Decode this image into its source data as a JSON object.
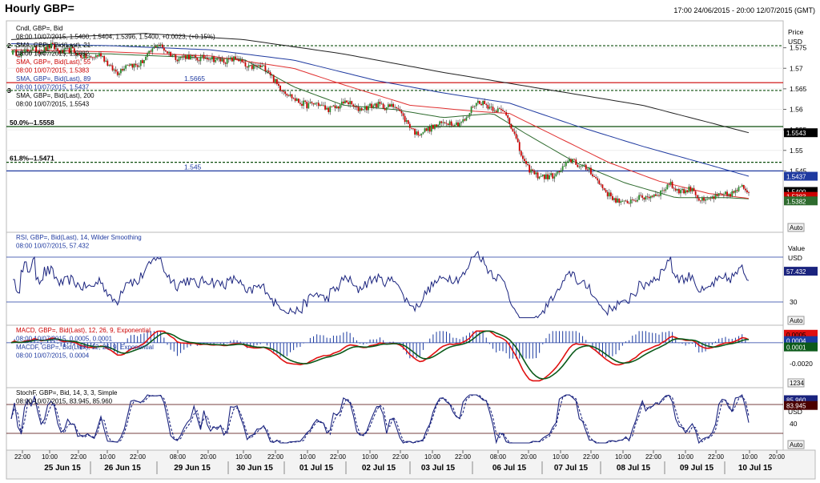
{
  "header": {
    "title": "Hourly GBP=",
    "date_range": "17:00 24/06/2015 - 20:00 12/07/2015 (GMT)"
  },
  "colors": {
    "candle_up": "#2a8a2a",
    "candle_down": "#cc0000",
    "sma21": "#2e6b2e",
    "sma55": "#e03030",
    "sma89": "#1f3aa0",
    "sma200": "#222222",
    "rsi": "#1a237e",
    "macd": "#e01010",
    "macdf": "#0b5a1a",
    "stoch_k": "#1a237e",
    "stoch_d": "#1a237e"
  },
  "price_panel": {
    "legend": [
      {
        "text": "Cndl, GBP=, Bid",
        "color": "#000000"
      },
      {
        "text": "08:00 10/07/2015, 1.5400, 1.5404, 1.5396, 1.5400, +0.0023, (+0.15%)",
        "color": "#000000"
      },
      {
        "text": "SMA, GBP=, Bid(Last), 21",
        "color": "#000000"
      },
      {
        "text": "08:00 10/07/2015, 1.5382",
        "color": "#000000"
      },
      {
        "text": "SMA, GBP=, Bid(Last), 55",
        "color": "#cc0000"
      },
      {
        "text": "08:00 10/07/2015, 1.5383",
        "color": "#cc0000"
      },
      {
        "text": "SMA, GBP=, Bid(Last), 89",
        "color": "#1f3aa0"
      },
      {
        "text": "08:00 10/07/2015, 1.5437",
        "color": "#1f3aa0"
      },
      {
        "text": "SMA, GBP=, Bid(Last), 200",
        "color": "#000000"
      },
      {
        "text": "08:00 10/07/2015, 1.5543",
        "color": "#000000"
      }
    ],
    "axis_title": "Price",
    "axis_unit": "USD",
    "ticks": [
      "1.575",
      "1.57",
      "1.565",
      "1.56",
      "1.555",
      "1.55",
      "1.545"
    ],
    "tick_values": [
      1.575,
      1.57,
      1.565,
      1.56,
      1.555,
      1.55,
      1.545
    ],
    "ylim": [
      1.532,
      1.58
    ],
    "badges": [
      {
        "text": "1.5543",
        "value": 1.5543,
        "bg": "#000000",
        "fg": "#ffffff"
      },
      {
        "text": "1.5437",
        "value": 1.5437,
        "bg": "#1f3aa0",
        "fg": "#ffffff"
      },
      {
        "text": "1.5400",
        "value": 1.54,
        "bg": "#000000",
        "fg": "#ffffff"
      },
      {
        "text": "1.5383",
        "value": 1.5388,
        "bg": "#cc0000",
        "fg": "#ffffff"
      },
      {
        "text": "1.5382",
        "value": 1.5377,
        "bg": "#2e6b2e",
        "fg": "#ffffff"
      }
    ],
    "hlines": [
      {
        "label": "1.5665",
        "value": 1.5665,
        "color": "#cc0000",
        "style": "solid",
        "label_color": "#1f3aa0"
      },
      {
        "label": "1.545",
        "value": 1.545,
        "color": "#1f3aa0",
        "style": "solid",
        "label_color": "#1f3aa0"
      },
      {
        "label": "50.0%--1.5558",
        "value": 1.5558,
        "color": "#0b4d0b",
        "style": "solid",
        "label_color": "#000000"
      },
      {
        "label": "61.8%--1.5471",
        "value": 1.5471,
        "color": "#0b4d0b",
        "style": "dashed",
        "label_color": "#000000"
      },
      {
        "label": "",
        "value": 1.5755,
        "color": "#0b4d0b",
        "style": "dashed",
        "label_color": "#000000"
      },
      {
        "label": "",
        "value": 1.5646,
        "color": "#0b4d0b",
        "style": "dashed",
        "label_color": "#000000"
      }
    ],
    "fib_fragments": [
      "2",
      "3"
    ],
    "auto_label": "Auto"
  },
  "rsi_panel": {
    "legend": [
      {
        "text": "RSI, GBP=, Bid(Last), 14, Wilder Smoothing",
        "color": "#1f3aa0"
      },
      {
        "text": "08:00 10/07/2015, 57.432",
        "color": "#1f3aa0"
      }
    ],
    "axis_title": "Value",
    "axis_unit": "USD",
    "ticks": [
      "30"
    ],
    "tick_values": [
      30
    ],
    "ylim": [
      15,
      85
    ],
    "levels": [
      70,
      30
    ],
    "badge": {
      "text": "57.432",
      "value": 57.432,
      "bg": "#1a237e",
      "fg": "#ffffff"
    },
    "auto_label": "Auto"
  },
  "macd_panel": {
    "legend": [
      {
        "text": "MACD, GBP=, Bid(Last), 12, 26, 9, Exponential",
        "color": "#cc0000"
      },
      {
        "text": "08:00 10/07/2015, 0.0005, 0.0001",
        "color": "#1f3aa0"
      },
      {
        "text": "MACDF, GBP=, Bid(Last), 12, 26, 9, Exponential",
        "color": "#1f3aa0"
      },
      {
        "text": "08:00 10/07/2015, 0.0004",
        "color": "#1f3aa0"
      }
    ],
    "ticks": [
      "-0.0020"
    ],
    "tick_values": [
      -0.002
    ],
    "ylim": [
      -0.0038,
      0.0012
    ],
    "badges": [
      {
        "text": "0.0005",
        "value": 0.0008,
        "bg": "#e01010",
        "fg": "#000000"
      },
      {
        "text": "0.0004",
        "value": 0.0002,
        "bg": "#1a3aa0",
        "fg": "#ffffff"
      },
      {
        "text": "0.0001",
        "value": -0.0004,
        "bg": "#0b5a1a",
        "fg": "#ffffff"
      }
    ],
    "auto_label": "1234"
  },
  "stoch_panel": {
    "legend": [
      {
        "text": "StochF, GBP=, Bid, 14, 3, 3, Simple",
        "color": "#000000"
      },
      {
        "text": "08:00 10/07/2015, 83.945, 85.960",
        "color": "#000000"
      }
    ],
    "axis_unit": "USD",
    "ticks": [
      "40"
    ],
    "tick_values": [
      40
    ],
    "ylim": [
      -5,
      105
    ],
    "levels": [
      80,
      20
    ],
    "badges": [
      {
        "text": "85.960",
        "value": 90,
        "bg": "#1a237e",
        "fg": "#ffffff"
      },
      {
        "text": "83.945",
        "value": 78,
        "bg": "#4a0000",
        "fg": "#ffffff"
      }
    ],
    "auto_label": "Auto"
  },
  "xaxis": {
    "time_labels": [
      "22:00",
      "10:00",
      "22:00",
      "10:00",
      "22:00",
      "08:00",
      "20:00",
      "10:00",
      "22:00",
      "10:00",
      "22:00",
      "10:00",
      "22:00",
      "10:00",
      "22:00",
      "08:00",
      "20:00",
      "10:00",
      "22:00",
      "10:00",
      "22:00",
      "10:00",
      "22:00",
      "10:00",
      "20:00"
    ],
    "time_positions": [
      28,
      62,
      98,
      134,
      172,
      222,
      260,
      304,
      344,
      384,
      422,
      462,
      500,
      540,
      578,
      622,
      660,
      700,
      738,
      778,
      816,
      856,
      894,
      936,
      970
    ],
    "date_labels": [
      "25 Jun 15",
      "26 Jun 15",
      "29 Jun 15",
      "30 Jun 15",
      "01 Jul 15",
      "02 Jul 15",
      "03 Jul 15",
      "06 Jul 15",
      "07 Jul 15",
      "08 Jul 15",
      "09 Jul 15",
      "10 Jul 15"
    ],
    "date_positions": [
      78,
      153,
      240,
      318,
      395,
      473,
      547,
      636,
      713,
      791,
      870,
      943
    ]
  },
  "chart_data": {
    "type": "candlestick",
    "title": "Hourly GBP=",
    "instrument": "GBP=",
    "ylabel": "Price USD",
    "ylim": [
      1.532,
      1.58
    ],
    "x_dates": [
      "25 Jun 15",
      "26 Jun 15",
      "29 Jun 15",
      "30 Jun 15",
      "01 Jul 15",
      "02 Jul 15",
      "03 Jul 15",
      "06 Jul 15",
      "07 Jul 15",
      "08 Jul 15",
      "09 Jul 15",
      "10 Jul 15"
    ],
    "close_path": [
      [
        0,
        1.574
      ],
      [
        6,
        1.5735
      ],
      [
        12,
        1.5748
      ],
      [
        18,
        1.5742
      ],
      [
        24,
        1.5755
      ],
      [
        30,
        1.5738
      ],
      [
        36,
        1.5745
      ],
      [
        42,
        1.573
      ],
      [
        48,
        1.5725
      ],
      [
        54,
        1.5735
      ],
      [
        60,
        1.57
      ],
      [
        64,
        1.569
      ],
      [
        70,
        1.5712
      ],
      [
        76,
        1.5705
      ],
      [
        82,
        1.573
      ],
      [
        88,
        1.576
      ],
      [
        94,
        1.574
      ],
      [
        100,
        1.5725
      ],
      [
        106,
        1.573
      ],
      [
        112,
        1.5722
      ],
      [
        118,
        1.5728
      ],
      [
        124,
        1.572
      ],
      [
        130,
        1.5718
      ],
      [
        136,
        1.5725
      ],
      [
        142,
        1.57
      ],
      [
        148,
        1.5705
      ],
      [
        154,
        1.57
      ],
      [
        160,
        1.566
      ],
      [
        166,
        1.564
      ],
      [
        172,
        1.562
      ],
      [
        178,
        1.561
      ],
      [
        184,
        1.5615
      ],
      [
        190,
        1.56
      ],
      [
        196,
        1.5605
      ],
      [
        202,
        1.562
      ],
      [
        208,
        1.56
      ],
      [
        214,
        1.5605
      ],
      [
        220,
        1.5612
      ],
      [
        226,
        1.5605
      ],
      [
        232,
        1.561
      ],
      [
        236,
        1.558
      ],
      [
        240,
        1.556
      ],
      [
        244,
        1.554
      ],
      [
        250,
        1.555
      ],
      [
        256,
        1.556
      ],
      [
        262,
        1.557
      ],
      [
        268,
        1.5565
      ],
      [
        274,
        1.5575
      ],
      [
        278,
        1.561
      ],
      [
        282,
        1.562
      ],
      [
        286,
        1.561
      ],
      [
        292,
        1.56
      ],
      [
        298,
        1.559
      ],
      [
        302,
        1.555
      ],
      [
        306,
        1.55
      ],
      [
        310,
        1.546
      ],
      [
        316,
        1.544
      ],
      [
        322,
        1.5435
      ],
      [
        328,
        1.544
      ],
      [
        334,
        1.5465
      ],
      [
        338,
        1.548
      ],
      [
        342,
        1.546
      ],
      [
        348,
        1.5455
      ],
      [
        352,
        1.543
      ],
      [
        356,
        1.541
      ],
      [
        360,
        1.539
      ],
      [
        364,
        1.538
      ],
      [
        368,
        1.537
      ],
      [
        374,
        1.538
      ],
      [
        380,
        1.5385
      ],
      [
        386,
        1.539
      ],
      [
        392,
        1.54
      ],
      [
        396,
        1.542
      ],
      [
        400,
        1.5405
      ],
      [
        406,
        1.54
      ],
      [
        410,
        1.541
      ],
      [
        414,
        1.538
      ],
      [
        418,
        1.5375
      ],
      [
        422,
        1.5385
      ],
      [
        428,
        1.539
      ],
      [
        434,
        1.5395
      ],
      [
        440,
        1.541
      ],
      [
        444,
        1.54
      ]
    ],
    "series": [
      {
        "name": "SMA 21",
        "last": 1.5382,
        "path": [
          [
            0,
            1.574
          ],
          [
            60,
            1.5735
          ],
          [
            100,
            1.5728
          ],
          [
            140,
            1.5722
          ],
          [
            170,
            1.5655
          ],
          [
            200,
            1.561
          ],
          [
            230,
            1.56
          ],
          [
            260,
            1.558
          ],
          [
            290,
            1.559
          ],
          [
            310,
            1.554
          ],
          [
            340,
            1.547
          ],
          [
            370,
            1.542
          ],
          [
            400,
            1.5385
          ],
          [
            430,
            1.5385
          ],
          [
            444,
            1.5382
          ]
        ]
      },
      {
        "name": "SMA 55",
        "last": 1.5383,
        "path": [
          [
            0,
            1.5745
          ],
          [
            60,
            1.574
          ],
          [
            120,
            1.573
          ],
          [
            170,
            1.57
          ],
          [
            200,
            1.566
          ],
          [
            240,
            1.561
          ],
          [
            280,
            1.5595
          ],
          [
            300,
            1.559
          ],
          [
            330,
            1.553
          ],
          [
            360,
            1.547
          ],
          [
            390,
            1.5425
          ],
          [
            420,
            1.5395
          ],
          [
            444,
            1.5383
          ]
        ]
      },
      {
        "name": "SMA 89",
        "last": 1.5437,
        "path": [
          [
            0,
            1.576
          ],
          [
            60,
            1.5755
          ],
          [
            120,
            1.5745
          ],
          [
            170,
            1.572
          ],
          [
            220,
            1.567
          ],
          [
            260,
            1.564
          ],
          [
            300,
            1.5615
          ],
          [
            340,
            1.556
          ],
          [
            380,
            1.551
          ],
          [
            420,
            1.5465
          ],
          [
            444,
            1.5437
          ]
        ]
      },
      {
        "name": "SMA 200",
        "last": 1.5543,
        "path": [
          [
            0,
            1.577
          ],
          [
            80,
            1.5785
          ],
          [
            140,
            1.577
          ],
          [
            200,
            1.5735
          ],
          [
            260,
            1.569
          ],
          [
            320,
            1.565
          ],
          [
            380,
            1.561
          ],
          [
            444,
            1.5543
          ]
        ]
      }
    ]
  }
}
